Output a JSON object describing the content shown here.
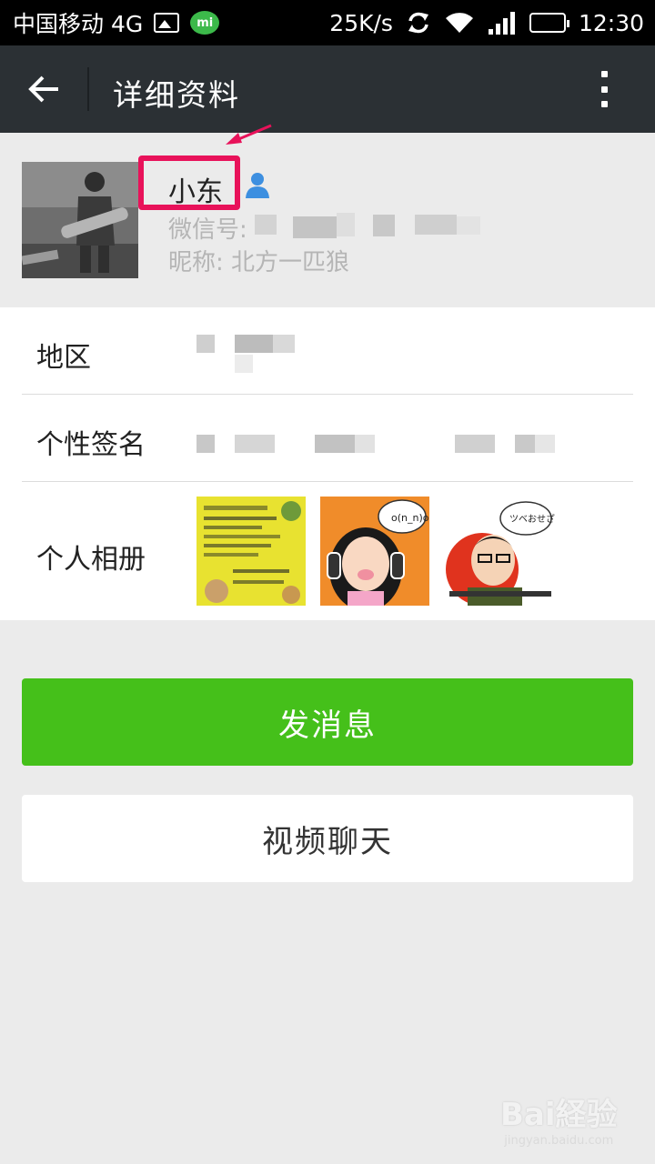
{
  "status_bar": {
    "carrier": "中国移动 4G",
    "speed": "25K/s",
    "time": "12:30"
  },
  "header": {
    "title": "详细资料"
  },
  "profile": {
    "name": "小东",
    "wechat_id_label": "微信号:",
    "nickname": "昵称: 北方一匹狼"
  },
  "details": {
    "region_label": "地区",
    "signature_label": "个性签名",
    "album_label": "个人相册"
  },
  "actions": {
    "send_message": "发消息",
    "video_chat": "视频聊天"
  },
  "colors": {
    "titlebar": "#2b3034",
    "accent_green": "#45c01a",
    "highlight": "#e8125a"
  },
  "watermark": {
    "brand": "Bai経验",
    "url": "jingyan.baidu.com"
  }
}
